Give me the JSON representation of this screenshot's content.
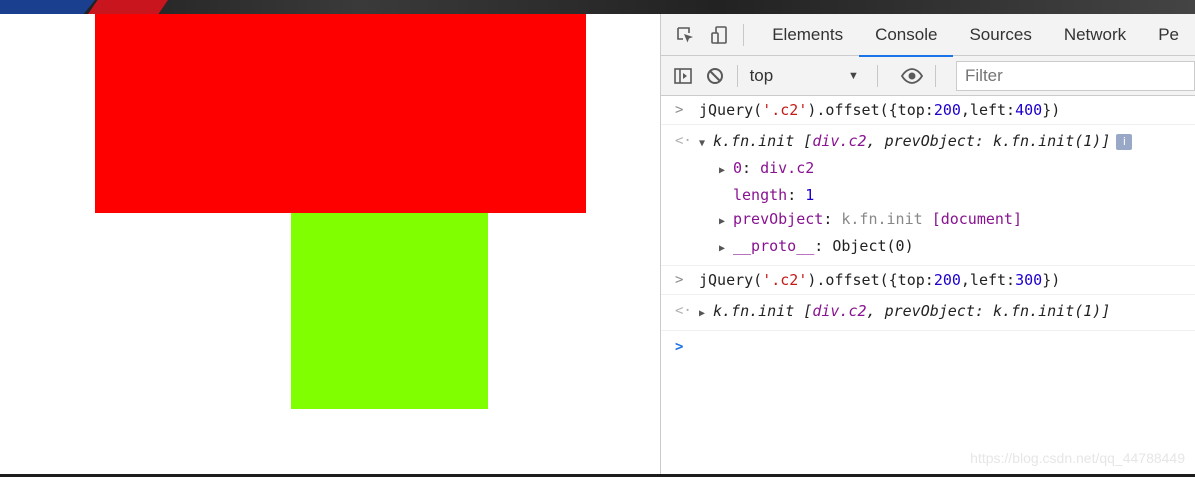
{
  "colors": {
    "red_box": "#ff0000",
    "green_box": "#7fff00",
    "accent": "#1a73e8"
  },
  "devtools": {
    "tabs": [
      "Elements",
      "Console",
      "Sources",
      "Network",
      "Pe"
    ],
    "active_tab": "Console",
    "toolbar": {
      "context": "top",
      "filter_placeholder": "Filter",
      "icons": [
        "sidebar-toggle-icon",
        "clear-console-icon",
        "chevron-down-icon",
        "eye-icon"
      ]
    },
    "tabbar_icons": [
      "inspect-element-icon",
      "device-toggle-icon"
    ]
  },
  "console": {
    "cmd1": {
      "prefix": "jQuery(",
      "arg": "'.c2'",
      "mid": ").offset({top:",
      "top": "200",
      "sep": ",left:",
      "left": "400",
      "end": "})"
    },
    "res1": {
      "head": "k.fn.init [",
      "node": "div.c2",
      "rest": ", prevObject: k.fn.init(1)]",
      "info": "i",
      "children": {
        "item0_key": "0",
        "item0_sep": ": ",
        "item0_val": "div.c2",
        "length_key": "length",
        "length_sep": ": ",
        "length_val": "1",
        "prev_key": "prevObject",
        "prev_sep": ": ",
        "prev_val": "k.fn.init",
        "prev_doc": "[document]",
        "proto_key": "__proto__",
        "proto_sep": ": ",
        "proto_val": "Object(0)"
      }
    },
    "cmd2": {
      "prefix": "jQuery(",
      "arg": "'.c2'",
      "mid": ").offset({top:",
      "top": "200",
      "sep": ",left:",
      "left": "300",
      "end": "})"
    },
    "res2": {
      "head": "k.fn.init [",
      "node": "div.c2",
      "rest": ", prevObject: k.fn.init(1)]"
    }
  },
  "watermark": "https://blog.csdn.net/qq_44788449"
}
